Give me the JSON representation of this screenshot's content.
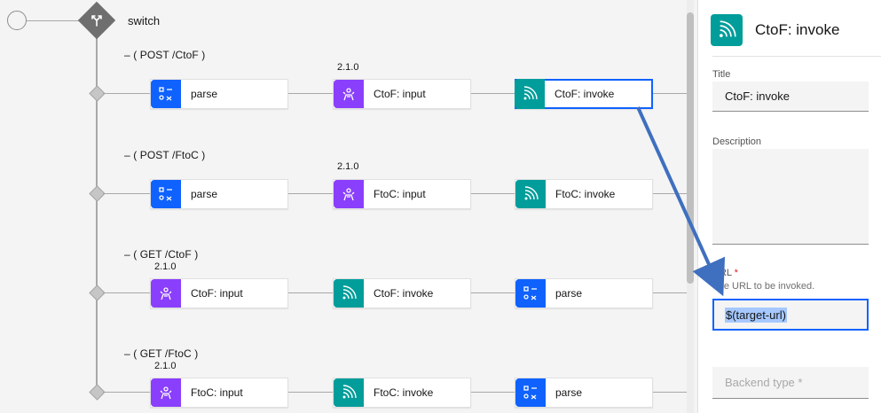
{
  "switch": {
    "label": "switch",
    "icon": "switch-branch-icon"
  },
  "branches": [
    {
      "case_label": "–     ( POST /CtoF )",
      "version": "2.1.0",
      "nodes": [
        {
          "label": "parse",
          "type": "parse",
          "icon": "parse-icon"
        },
        {
          "label": "CtoF: input",
          "type": "input",
          "icon": "input-icon"
        },
        {
          "label": "CtoF: invoke",
          "type": "invoke",
          "icon": "invoke-icon",
          "selected": true
        }
      ]
    },
    {
      "case_label": "–     ( POST /FtoC )",
      "version": "2.1.0",
      "nodes": [
        {
          "label": "parse",
          "type": "parse",
          "icon": "parse-icon"
        },
        {
          "label": "FtoC: input",
          "type": "input",
          "icon": "input-icon"
        },
        {
          "label": "FtoC: invoke",
          "type": "invoke",
          "icon": "invoke-icon"
        }
      ]
    },
    {
      "case_label": "–     ( GET /CtoF )",
      "version": "2.1.0",
      "nodes": [
        {
          "label": "CtoF: input",
          "type": "input",
          "icon": "input-icon"
        },
        {
          "label": "CtoF: invoke",
          "type": "invoke",
          "icon": "invoke-icon"
        },
        {
          "label": "parse",
          "type": "parse",
          "icon": "parse-icon"
        }
      ]
    },
    {
      "case_label": "–     ( GET /FtoC )",
      "version": "2.1.0",
      "nodes": [
        {
          "label": "FtoC: input",
          "type": "input",
          "icon": "input-icon"
        },
        {
          "label": "FtoC: invoke",
          "type": "invoke",
          "icon": "invoke-icon"
        },
        {
          "label": "parse",
          "type": "parse",
          "icon": "parse-icon"
        }
      ]
    }
  ],
  "panel": {
    "title": "CtoF: invoke",
    "icon": "invoke-icon",
    "title_field": {
      "label": "Title",
      "value": "CtoF: invoke"
    },
    "description_field": {
      "label": "Description",
      "value": ""
    },
    "url_field": {
      "label": "URL",
      "required_marker": "*",
      "helper": "The URL to be invoked.",
      "value": "$(target-url)"
    },
    "backend_type_field": {
      "placeholder": "Backend type *"
    }
  },
  "colors": {
    "parse": "#0f62fe",
    "input": "#8a3ffc",
    "invoke": "#009d9a",
    "selection": "#0f62fe",
    "canvas_background": "#f4f4f4",
    "annotation_arrow": "#3f6fbf"
  }
}
